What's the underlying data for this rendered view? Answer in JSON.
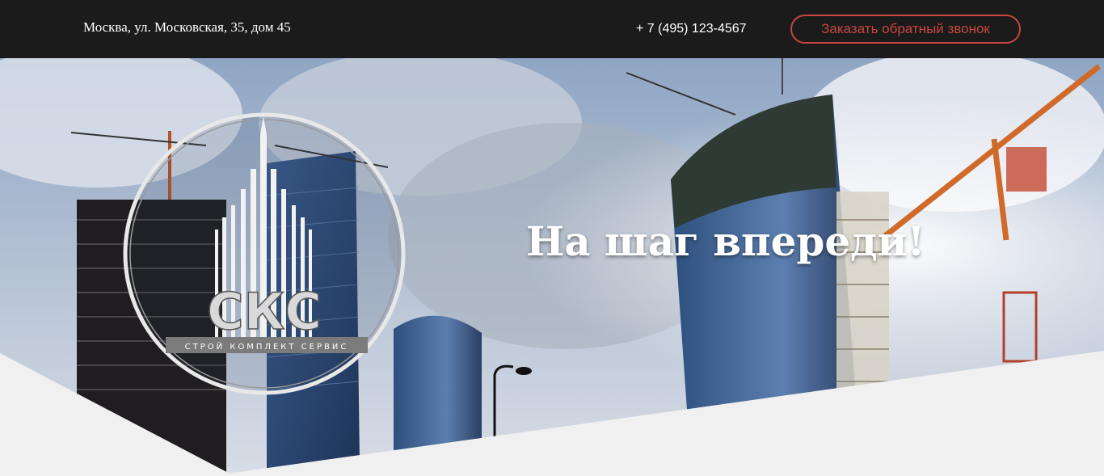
{
  "header": {
    "address": "Москва, ул. Московская, 35, дом 45",
    "phone": "+ 7 (495) 123-4567",
    "callback_label": "Заказать обратный звонок"
  },
  "hero": {
    "headline": "На шаг впереди!",
    "logo_text": "СКС",
    "logo_subtitle": "СТРОЙ КОМПЛЕКТ СЕРВИС"
  },
  "colors": {
    "topbar_bg": "#1b1b1b",
    "accent": "#c6463f",
    "footer_wedge": "#f0f0f0"
  },
  "icons": [
    "building-logo-icon"
  ]
}
